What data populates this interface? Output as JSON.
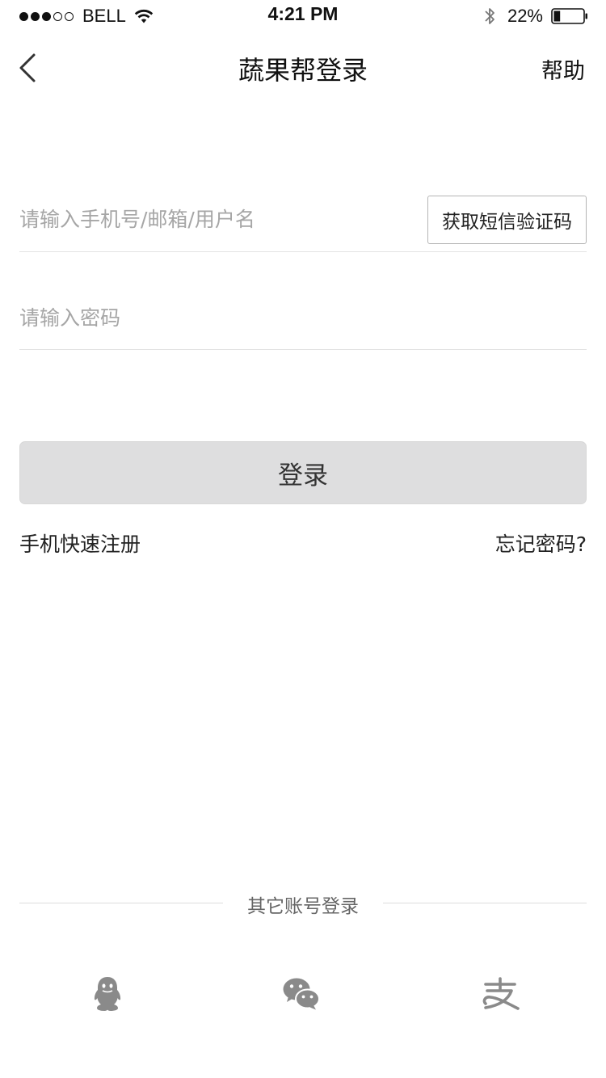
{
  "status_bar": {
    "carrier": "BELL",
    "time": "4:21 PM",
    "battery": "22%",
    "signal_bars_filled": 3,
    "signal_bars_total": 5,
    "battery_level": 0.22
  },
  "nav": {
    "title": "蔬果帮登录",
    "help": "帮助",
    "back_icon": "chevron-left-icon"
  },
  "form": {
    "account_placeholder": "请输入手机号/邮箱/用户名",
    "account_value": "",
    "sms_button": "获取短信验证码",
    "password_placeholder": "请输入密码",
    "password_value": "",
    "login_button": "登录"
  },
  "links": {
    "register": "手机快速注册",
    "forgot": "忘记密码?"
  },
  "other_login": {
    "title": "其它账号登录",
    "providers": [
      {
        "icon": "qq-icon"
      },
      {
        "icon": "wechat-icon"
      },
      {
        "icon": "alipay-icon"
      }
    ]
  },
  "colors": {
    "login_button_bg": "#dededf",
    "divider": "#e3e3e3",
    "placeholder": "#a6a6a6",
    "icon_gray": "#8a8a8a"
  }
}
